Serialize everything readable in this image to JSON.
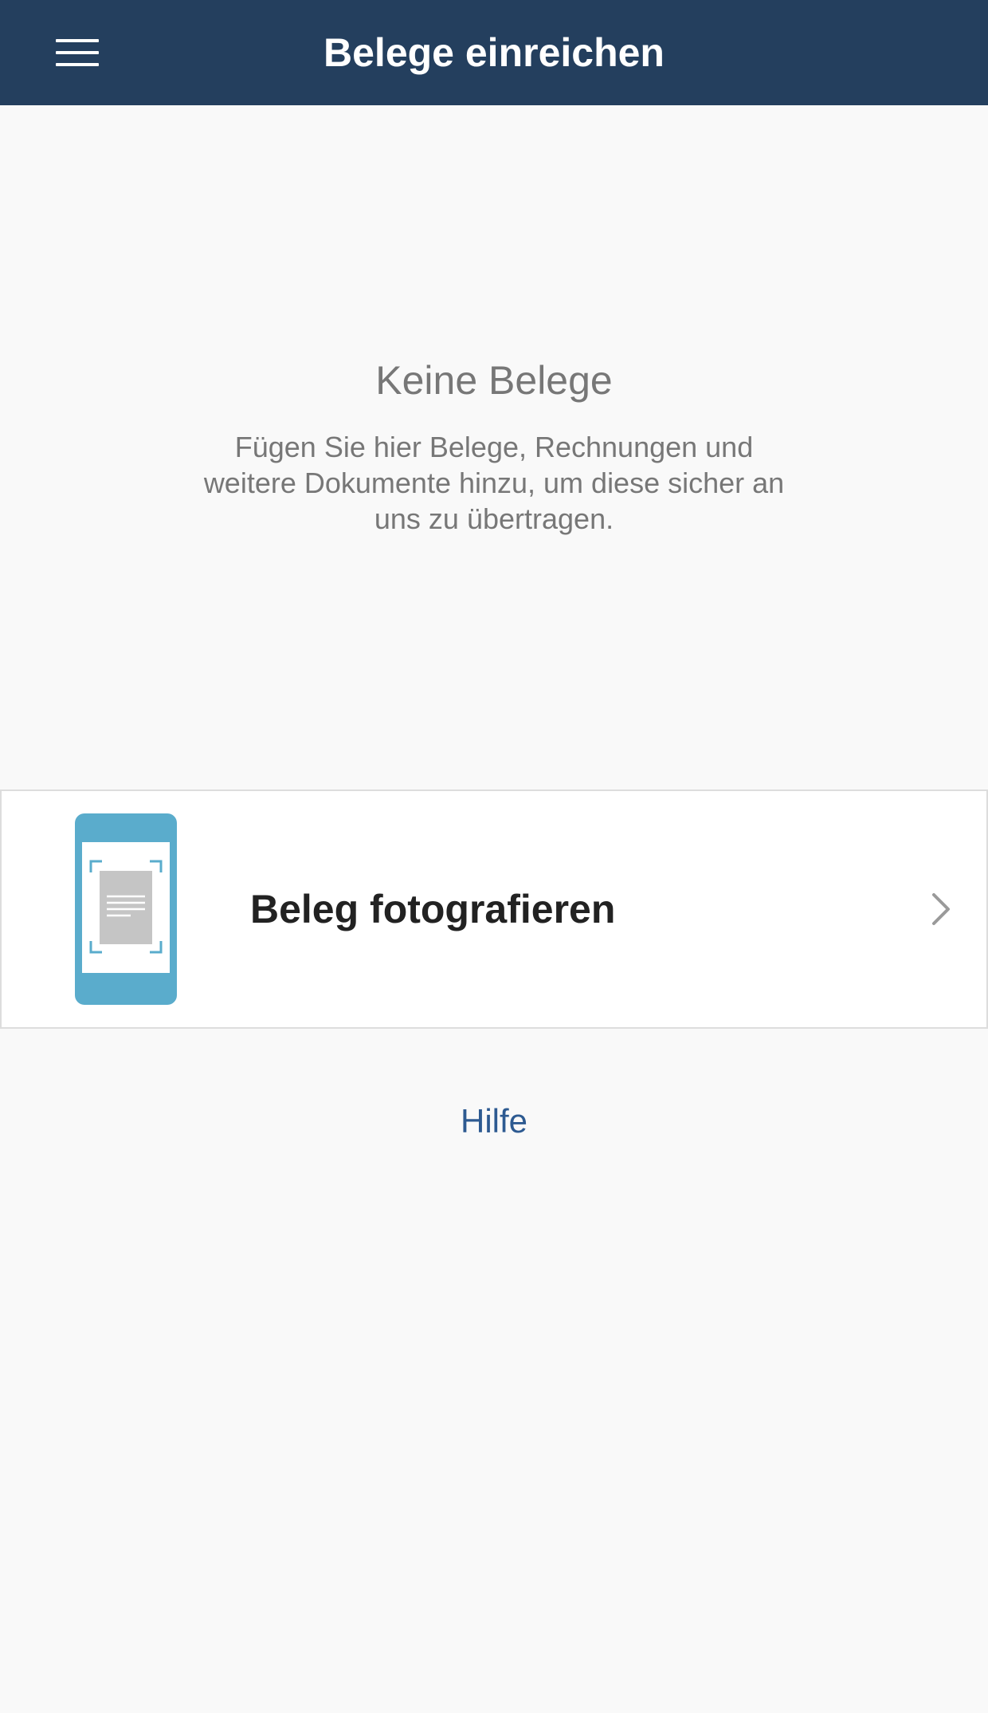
{
  "header": {
    "title": "Belege einreichen",
    "menu_icon": "hamburger-menu-icon",
    "background_color": "#243f5e"
  },
  "empty_state": {
    "title": "Keine Belege",
    "description": "Fügen Sie hier Belege, Rechnungen und weitere Dokumente hinzu, um diese sicher an uns zu übertragen."
  },
  "actions": {
    "photo": {
      "label": "Beleg fotografieren",
      "icon": "phone-scan-document-icon",
      "chevron_icon": "chevron-right-icon",
      "icon_color": "#5aaccc"
    }
  },
  "help": {
    "label": "Hilfe",
    "color": "#2d5a91"
  }
}
